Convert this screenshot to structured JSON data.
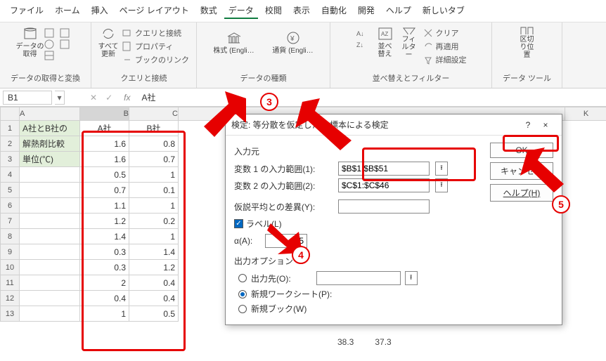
{
  "menu": {
    "file": "ファイル",
    "home": "ホーム",
    "insert": "挿入",
    "pagelayout": "ページ レイアウト",
    "formulas": "数式",
    "data": "データ",
    "review": "校閲",
    "view": "表示",
    "auto": "自動化",
    "dev": "開発",
    "help": "ヘルプ",
    "newtab": "新しいタブ"
  },
  "ribbon": {
    "g1": {
      "label": "データの取得と変換",
      "main": "データの\n取得"
    },
    "g2": {
      "label": "クエリと接続",
      "main": "すべて\n更新",
      "i1": "クエリと接続",
      "i2": "プロパティ",
      "i3": "ブックのリンク"
    },
    "g3": {
      "label": "データの種類",
      "a": "株式 (Engli…",
      "b": "通貨 (Engli…"
    },
    "g4": {
      "label": "並べ替えとフィルター",
      "sort": "並べ替え",
      "filter": "フィルター",
      "clear": "クリア",
      "reapply": "再適用",
      "adv": "詳細設定"
    },
    "g5": {
      "label": "データ ツール",
      "main": "区切り位置"
    }
  },
  "formula": {
    "name": "B1",
    "fx": "fx",
    "val": "A社",
    "cancel": "✕",
    "ok": "✓"
  },
  "headers": {
    "A": "A",
    "B": "B",
    "C": "C",
    "K": "K"
  },
  "rows": [
    "1",
    "2",
    "3",
    "4",
    "5",
    "6",
    "7",
    "8",
    "9",
    "10",
    "11",
    "12",
    "13"
  ],
  "colA": [
    "A社とB社の",
    "解熱剤比較",
    "単位(℃)",
    "",
    "",
    "",
    "",
    "",
    "",
    "",
    "",
    "",
    ""
  ],
  "colB": [
    "A社",
    "1.6",
    "1.6",
    "0.5",
    "0.7",
    "1.1",
    "1.2",
    "1.4",
    "0.3",
    "0.3",
    "2",
    "0.4",
    "1"
  ],
  "colC": [
    "B社",
    "0.8",
    "0.7",
    "1",
    "0.1",
    "1",
    "0.2",
    "1",
    "1.4",
    "1.2",
    "0.4",
    "0.4",
    "0.5"
  ],
  "dialog": {
    "title": "検定: 等分散を仮定した 2 標本による検定",
    "help": "?",
    "close": "×",
    "ok": "OK",
    "cancel": "キャンセル",
    "helpbtn": "ヘルプ(H)",
    "sect_in": "入力元",
    "var1": "変数 1 の入力範囲(1):",
    "var1v": "$B$1:$B$51",
    "var2": "変数 2 の入力範囲(2):",
    "var2v": "$C$1:$C$46",
    "hyp": "仮説平均との差異(Y):",
    "hypv": "",
    "label_chk": "ラベル(L)",
    "alpha": "α(A):",
    "alphav": "05",
    "sect_out": "出力オプション",
    "out1": "出力先(O):",
    "out2": "新規ワークシート(P):",
    "out3": "新規ブック(W)"
  },
  "float": {
    "a": "38.3",
    "b": "37.3"
  },
  "annot": {
    "n3": "3",
    "n4": "4",
    "n5": "5"
  }
}
